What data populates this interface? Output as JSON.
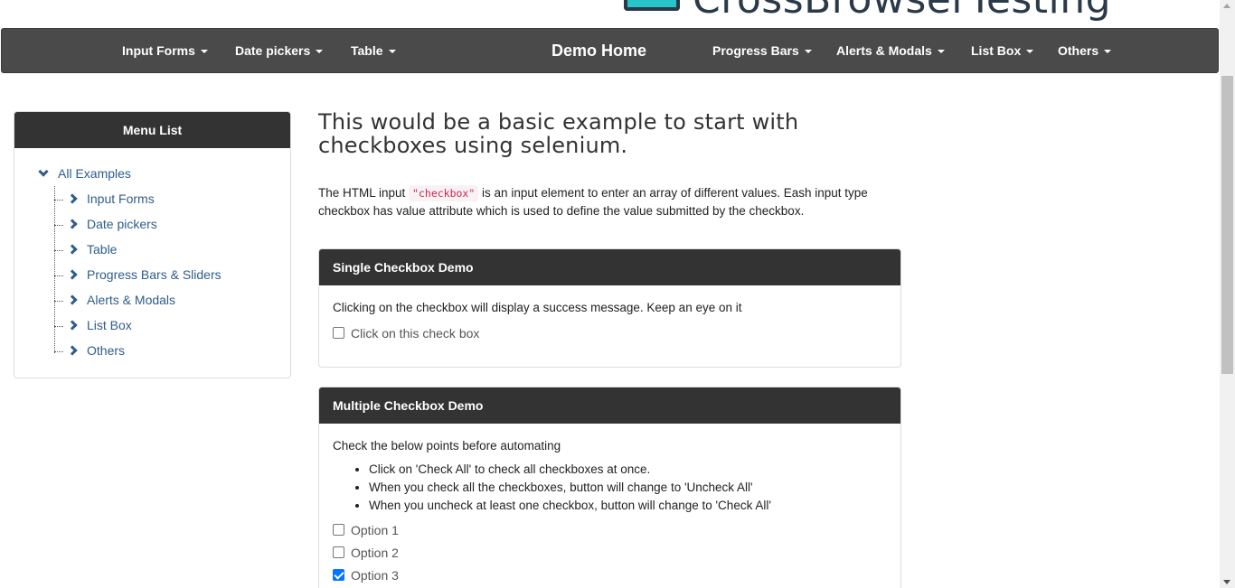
{
  "logo": {
    "text": "CrossBrowserTesting"
  },
  "navbar": {
    "left": [
      "Input Forms",
      "Date pickers",
      "Table"
    ],
    "home": "Demo Home",
    "right": [
      "Progress Bars",
      "Alerts & Modals",
      "List Box",
      "Others"
    ]
  },
  "sidebar": {
    "title": "Menu List",
    "root": "All Examples",
    "items": [
      "Input Forms",
      "Date pickers",
      "Table",
      "Progress Bars & Sliders",
      "Alerts & Modals",
      "List Box",
      "Others"
    ]
  },
  "main": {
    "title": "This would be a basic example to start with checkboxes using selenium.",
    "intro_before": "The HTML input ",
    "intro_code": "\"checkbox\"",
    "intro_after": " is an input element to enter an array of different values. Eash input type checkbox has value attribute which is used to define the value submitted by the checkbox."
  },
  "single": {
    "header": "Single Checkbox Demo",
    "text": "Clicking on the checkbox will display a success message. Keep an eye on it",
    "checkbox_label": "Click on this check box",
    "checked": false
  },
  "multiple": {
    "header": "Multiple Checkbox Demo",
    "text": "Check the below points before automating",
    "points": [
      "Click on 'Check All' to check all checkboxes at once.",
      "When you check all the checkboxes, button will change to 'Uncheck All'",
      "When you uncheck at least one checkbox, button will change to 'Check All'"
    ],
    "options": [
      {
        "label": "Option 1",
        "checked": false
      },
      {
        "label": "Option 2",
        "checked": false
      },
      {
        "label": "Option 3",
        "checked": true
      }
    ]
  },
  "colors": {
    "navbar": "#4a4a4a",
    "panel_header": "#333333",
    "link": "#2f5d8a",
    "checkbox_checked": "#0075ff"
  }
}
